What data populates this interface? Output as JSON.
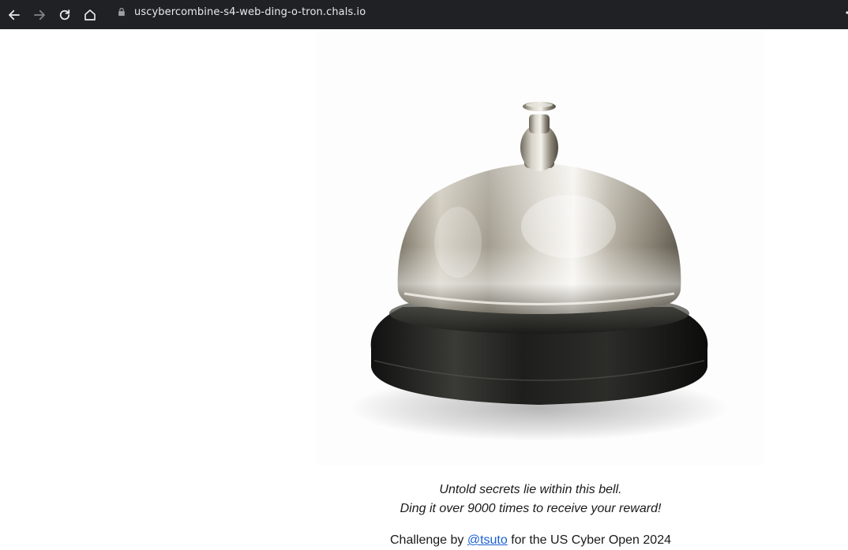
{
  "browser": {
    "url": "uscybercombine-s4-web-ding-o-tron.chals.io",
    "back_icon": "arrow-left-icon",
    "forward_icon": "arrow-right-icon",
    "reload_icon": "reload-icon",
    "home_icon": "home-icon",
    "lock_icon": "lock-icon"
  },
  "page": {
    "image_icon": "service-bell-icon",
    "caption_line_1": "Untold secrets lie within this bell.",
    "caption_line_2": "Ding it over 9000 times to receive your reward!",
    "credit_prefix": "Challenge by ",
    "credit_link": "@tsuto",
    "credit_suffix": " for the US Cyber Open 2024"
  },
  "colors": {
    "chrome_bg": "#202124",
    "link": "#1a5fd0"
  }
}
